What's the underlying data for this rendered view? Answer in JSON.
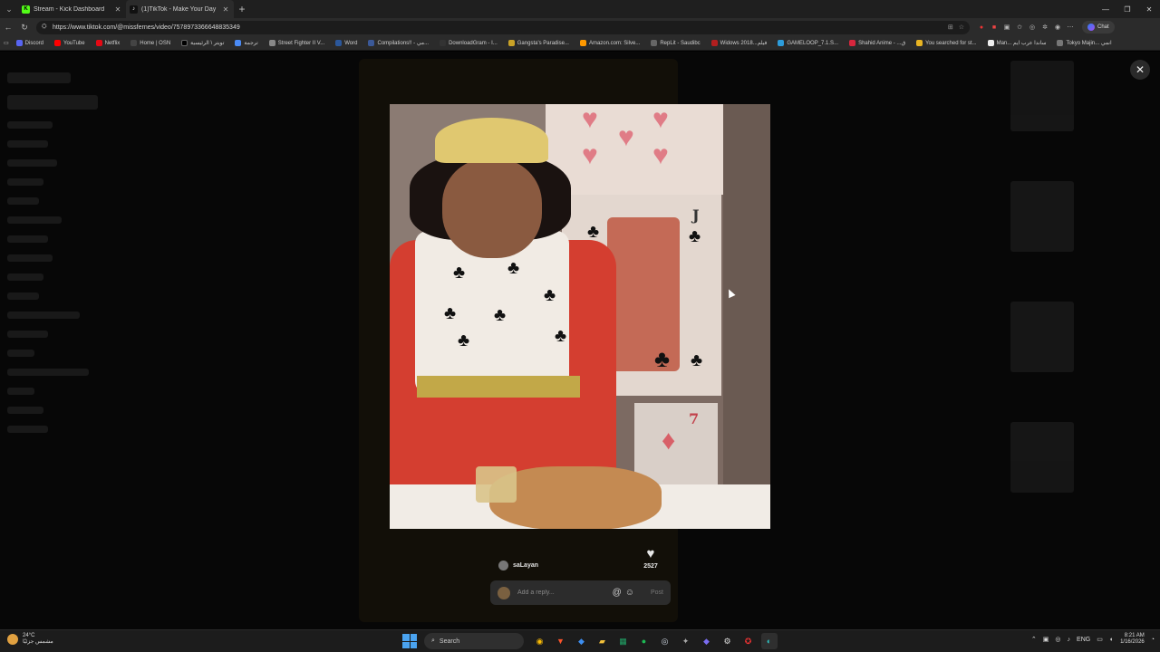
{
  "browser": {
    "tabs": [
      {
        "title": "Stream - Kick Dashboard",
        "icon": "kick-icon",
        "color": "#53fc18",
        "glyph": "K",
        "active": false
      },
      {
        "title": "(1)TikTok - Make Your Day",
        "icon": "tiktok-icon",
        "color": "#ffffff",
        "glyph": "♪",
        "active": true
      }
    ],
    "url": "https://www.tiktok.com/@missfernes/video/7578973366648835349",
    "chat_label": "Chat"
  },
  "bookmarks": [
    {
      "label": "Discord",
      "color": "#5865f2"
    },
    {
      "label": "YouTube",
      "color": "#ff0000"
    },
    {
      "label": "Netflix",
      "color": "#e50914"
    },
    {
      "label": "Home | OSN",
      "color": "#222222"
    },
    {
      "label": "تويتر \\ الرئيسية",
      "color": "#000000"
    },
    {
      "label": "ترجمة",
      "color": "#4a8af4"
    },
    {
      "label": "Street Fighter II V...",
      "color": "#888888"
    },
    {
      "label": "Word",
      "color": "#2b579a"
    },
    {
      "label": "Compilations!! - مي...",
      "color": "#3b5998"
    },
    {
      "label": "DownloadGram - I...",
      "color": "#333333"
    },
    {
      "label": "Gangsta's Paradise...",
      "color": "#c9a227"
    },
    {
      "label": "Amazon.com: Silve...",
      "color": "#ff9900"
    },
    {
      "label": "RepLit - Saudibc",
      "color": "#666666"
    },
    {
      "label": "Widows 2018...فيلم",
      "color": "#b21f1f"
    },
    {
      "label": "GAMELOOP_7.1.S...",
      "color": "#2d9cdb"
    },
    {
      "label": "Shahid Anime - ...ق",
      "color": "#d7263d"
    },
    {
      "label": "You searched for st...",
      "color": "#e8b423"
    },
    {
      "label": "Man... ساندا عرب ايم",
      "color": "#eeeeee"
    },
    {
      "label": "Tokyo Majin... انمي",
      "color": "#777777"
    }
  ],
  "video": {
    "card_letter_j": "J",
    "card_letter_7": "7"
  },
  "engagement": {
    "like_count": "2527"
  },
  "reply": {
    "username": "saLayan",
    "placeholder": "Add a reply...",
    "post_label": "Post"
  },
  "taskbar": {
    "weather_temp": "24°C",
    "weather_desc": "مشمس جزئيًا",
    "search_label": "Search",
    "language": "ENG",
    "time": "8:21 AM",
    "date": "1/16/2026"
  }
}
